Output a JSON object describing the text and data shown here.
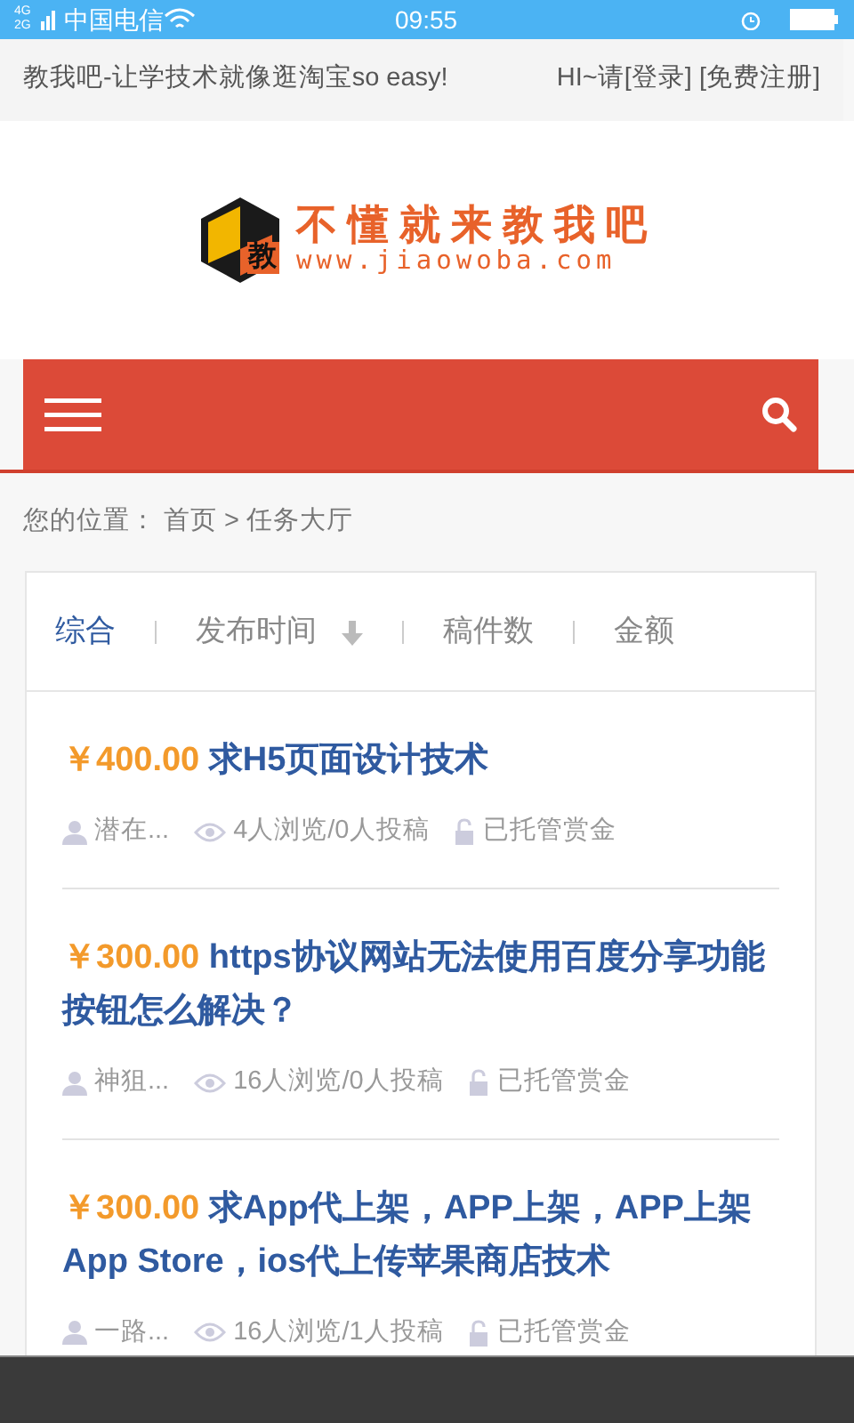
{
  "status_bar": {
    "network": "4G 2G",
    "carrier": "中国电信",
    "time": "09:55"
  },
  "top_bar": {
    "slogan": "教我吧-让学技术就像逛淘宝so easy!",
    "greeting": "HI~请",
    "login": "[登录]",
    "register": "[免费注册]"
  },
  "logo": {
    "badge": "教",
    "title": "不懂就来教我吧",
    "url": "www.jiaowoba.com"
  },
  "breadcrumb": {
    "label": "您的位置：",
    "links": [
      "首页",
      "任务大厅"
    ],
    "separator": ">"
  },
  "sort_tabs": [
    {
      "label": "综合",
      "selected": true,
      "kind": "plain"
    },
    {
      "label": "发布时间",
      "selected": false,
      "kind": "sort"
    },
    {
      "label": "稿件数",
      "selected": false,
      "kind": "plain"
    },
    {
      "label": "金额",
      "selected": false,
      "kind": "plain"
    }
  ],
  "tasks": [
    {
      "price": "￥400.00",
      "title": "求H5页面设计技术",
      "author": "潜在...",
      "stats": "4人浏览/0人投稿",
      "escrow": "已托管赏金"
    },
    {
      "price": "￥300.00",
      "title": "https协议网站无法使用百度分享功能按钮怎么解决？",
      "author": "神狙...",
      "stats": "16人浏览/0人投稿",
      "escrow": "已托管赏金"
    },
    {
      "price": "￥300.00",
      "title": "求App代上架，APP上架，APP上架App Store，ios代上传苹果商店技术",
      "author": "一路...",
      "stats": "16人浏览/1人投稿",
      "escrow": "已托管赏金"
    }
  ]
}
